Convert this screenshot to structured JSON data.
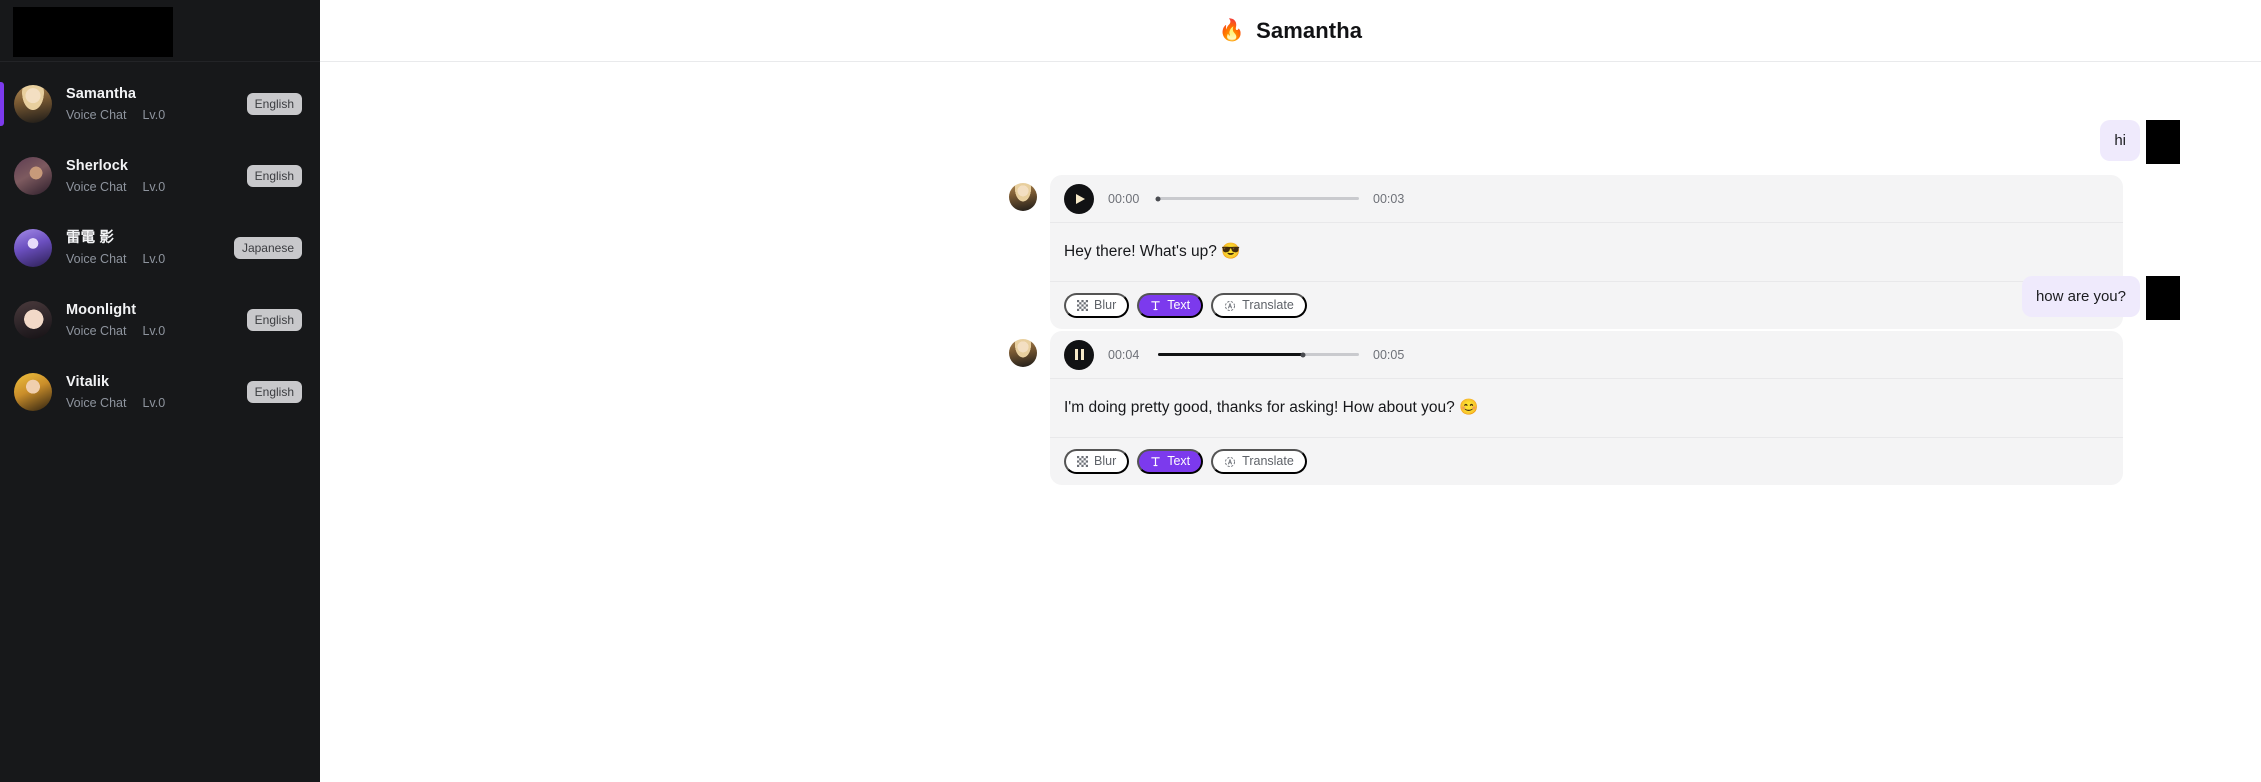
{
  "sidebar": {
    "logo": {
      "name": "app-logo",
      "redacted": true
    },
    "chats": [
      {
        "name": "Samantha",
        "mode": "Voice Chat",
        "level": "Lv.0",
        "language": "English",
        "active": true,
        "avatar": "av-samantha"
      },
      {
        "name": "Sherlock",
        "mode": "Voice Chat",
        "level": "Lv.0",
        "language": "English",
        "active": false,
        "avatar": "av-sherlock"
      },
      {
        "name": "雷電 影",
        "mode": "Voice Chat",
        "level": "Lv.0",
        "language": "Japanese",
        "active": false,
        "avatar": "av-raiden"
      },
      {
        "name": "Moonlight",
        "mode": "Voice Chat",
        "level": "Lv.0",
        "language": "English",
        "active": false,
        "avatar": "av-moonlight"
      },
      {
        "name": "Vitalik",
        "mode": "Voice Chat",
        "level": "Lv.0",
        "language": "English",
        "active": false,
        "avatar": "av-vitalik"
      }
    ]
  },
  "header": {
    "title": "Samantha",
    "emoji": "🔥"
  },
  "messages": [
    {
      "role": "user",
      "text": "hi"
    },
    {
      "role": "assistant",
      "audio": {
        "state": "paused",
        "current_time": "00:00",
        "duration": "00:03",
        "progress_percent": 0
      },
      "text": "Hey there! What's up? 😎",
      "actions": [
        {
          "label": "Blur",
          "icon": "blur-icon",
          "active": false
        },
        {
          "label": "Text",
          "icon": "text-icon",
          "active": true
        },
        {
          "label": "Translate",
          "icon": "translate-icon",
          "active": false
        }
      ]
    },
    {
      "role": "user",
      "text": "how are you?"
    },
    {
      "role": "assistant",
      "audio": {
        "state": "playing",
        "current_time": "00:04",
        "duration": "00:05",
        "progress_percent": 72
      },
      "text": "I'm doing pretty good, thanks for asking! How about you? 😊",
      "actions": [
        {
          "label": "Blur",
          "icon": "blur-icon",
          "active": false
        },
        {
          "label": "Text",
          "icon": "text-icon",
          "active": true
        },
        {
          "label": "Translate",
          "icon": "translate-icon",
          "active": false
        }
      ]
    }
  ],
  "colors": {
    "accent": "#7c3aed",
    "sidebar_bg": "#17181a",
    "bubble_user": "#efeafc",
    "bubble_bot": "#f4f4f5",
    "badge_bg": "#c8c8cb"
  }
}
